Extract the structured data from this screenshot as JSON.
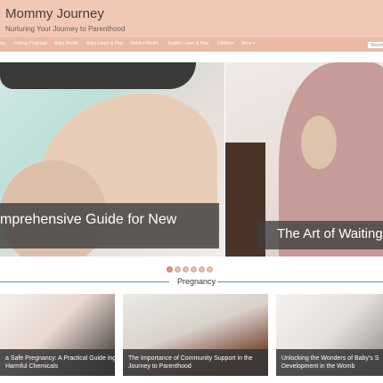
{
  "header": {
    "title": "Mommy Journey",
    "tagline": "Nurturing Your Journey to Parenthood"
  },
  "nav": {
    "items": [
      "ncy",
      "Getting Pregnant",
      "Baby Health",
      "Baby Learn & Play",
      "Toddler Health",
      "Toddler Learn & Play",
      "Children",
      "More ▾"
    ],
    "search_placeholder": "Search"
  },
  "slider": {
    "slide1_caption": "mprehensive Guide for New",
    "slide2_caption": "The Art of Waiting",
    "dots": [
      "1",
      "2",
      "3",
      "4",
      "5",
      "6"
    ]
  },
  "section": {
    "title": "Pregnancy"
  },
  "cards": [
    {
      "title": "a Safe Pregnancy: A Practical Guide ing Harmful Chemicals"
    },
    {
      "title": "The Importance of Community Support in the Journey to Parenthood"
    },
    {
      "title": "Unlocking the Wonders of Baby's S Development in the Womb"
    }
  ]
}
